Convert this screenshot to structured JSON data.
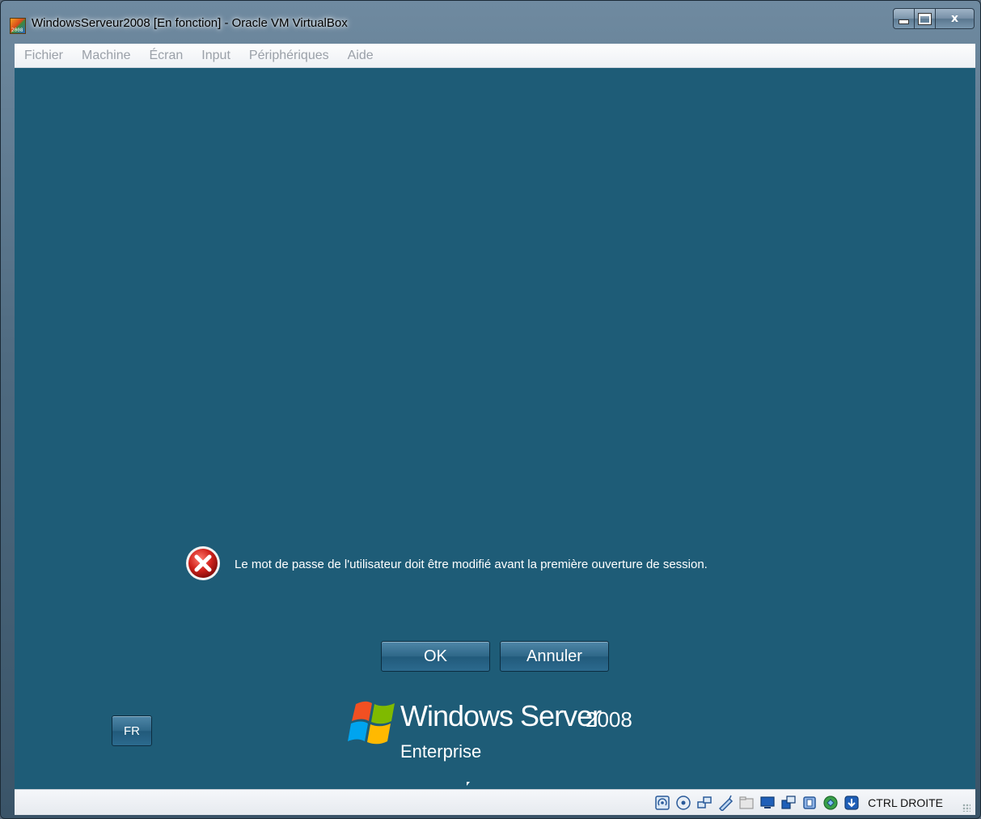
{
  "window": {
    "title": "WindowsServeur2008 [En fonction] - Oracle VM VirtualBox",
    "app_icon_text": "2008",
    "controls": {
      "minimize": "minimize",
      "maximize": "maximize",
      "close": "x"
    }
  },
  "menubar": {
    "items": [
      {
        "label": "Fichier"
      },
      {
        "label": "Machine"
      },
      {
        "label": "Écran"
      },
      {
        "label": "Input"
      },
      {
        "label": "Périphériques"
      },
      {
        "label": "Aide"
      }
    ]
  },
  "vm": {
    "background_color": "#1e5c77",
    "error_message": "Le mot de passe de l'utilisateur doit être modifié avant la première ouverture de session.",
    "ok_label": "OK",
    "cancel_label": "Annuler",
    "language_label": "FR",
    "logo": {
      "brand": "Windows Server",
      "year": "2008",
      "edition": "Enterprise"
    }
  },
  "statusbar": {
    "icons": [
      "hard-disk-icon",
      "optical-drive-icon",
      "network-icon",
      "usb-icon",
      "shared-folders-icon",
      "display-icon",
      "video-capture-icon",
      "cpu-virtualization-icon",
      "mouse-integration-icon",
      "keyboard-capture-icon"
    ],
    "host_key": "CTRL DROITE"
  }
}
